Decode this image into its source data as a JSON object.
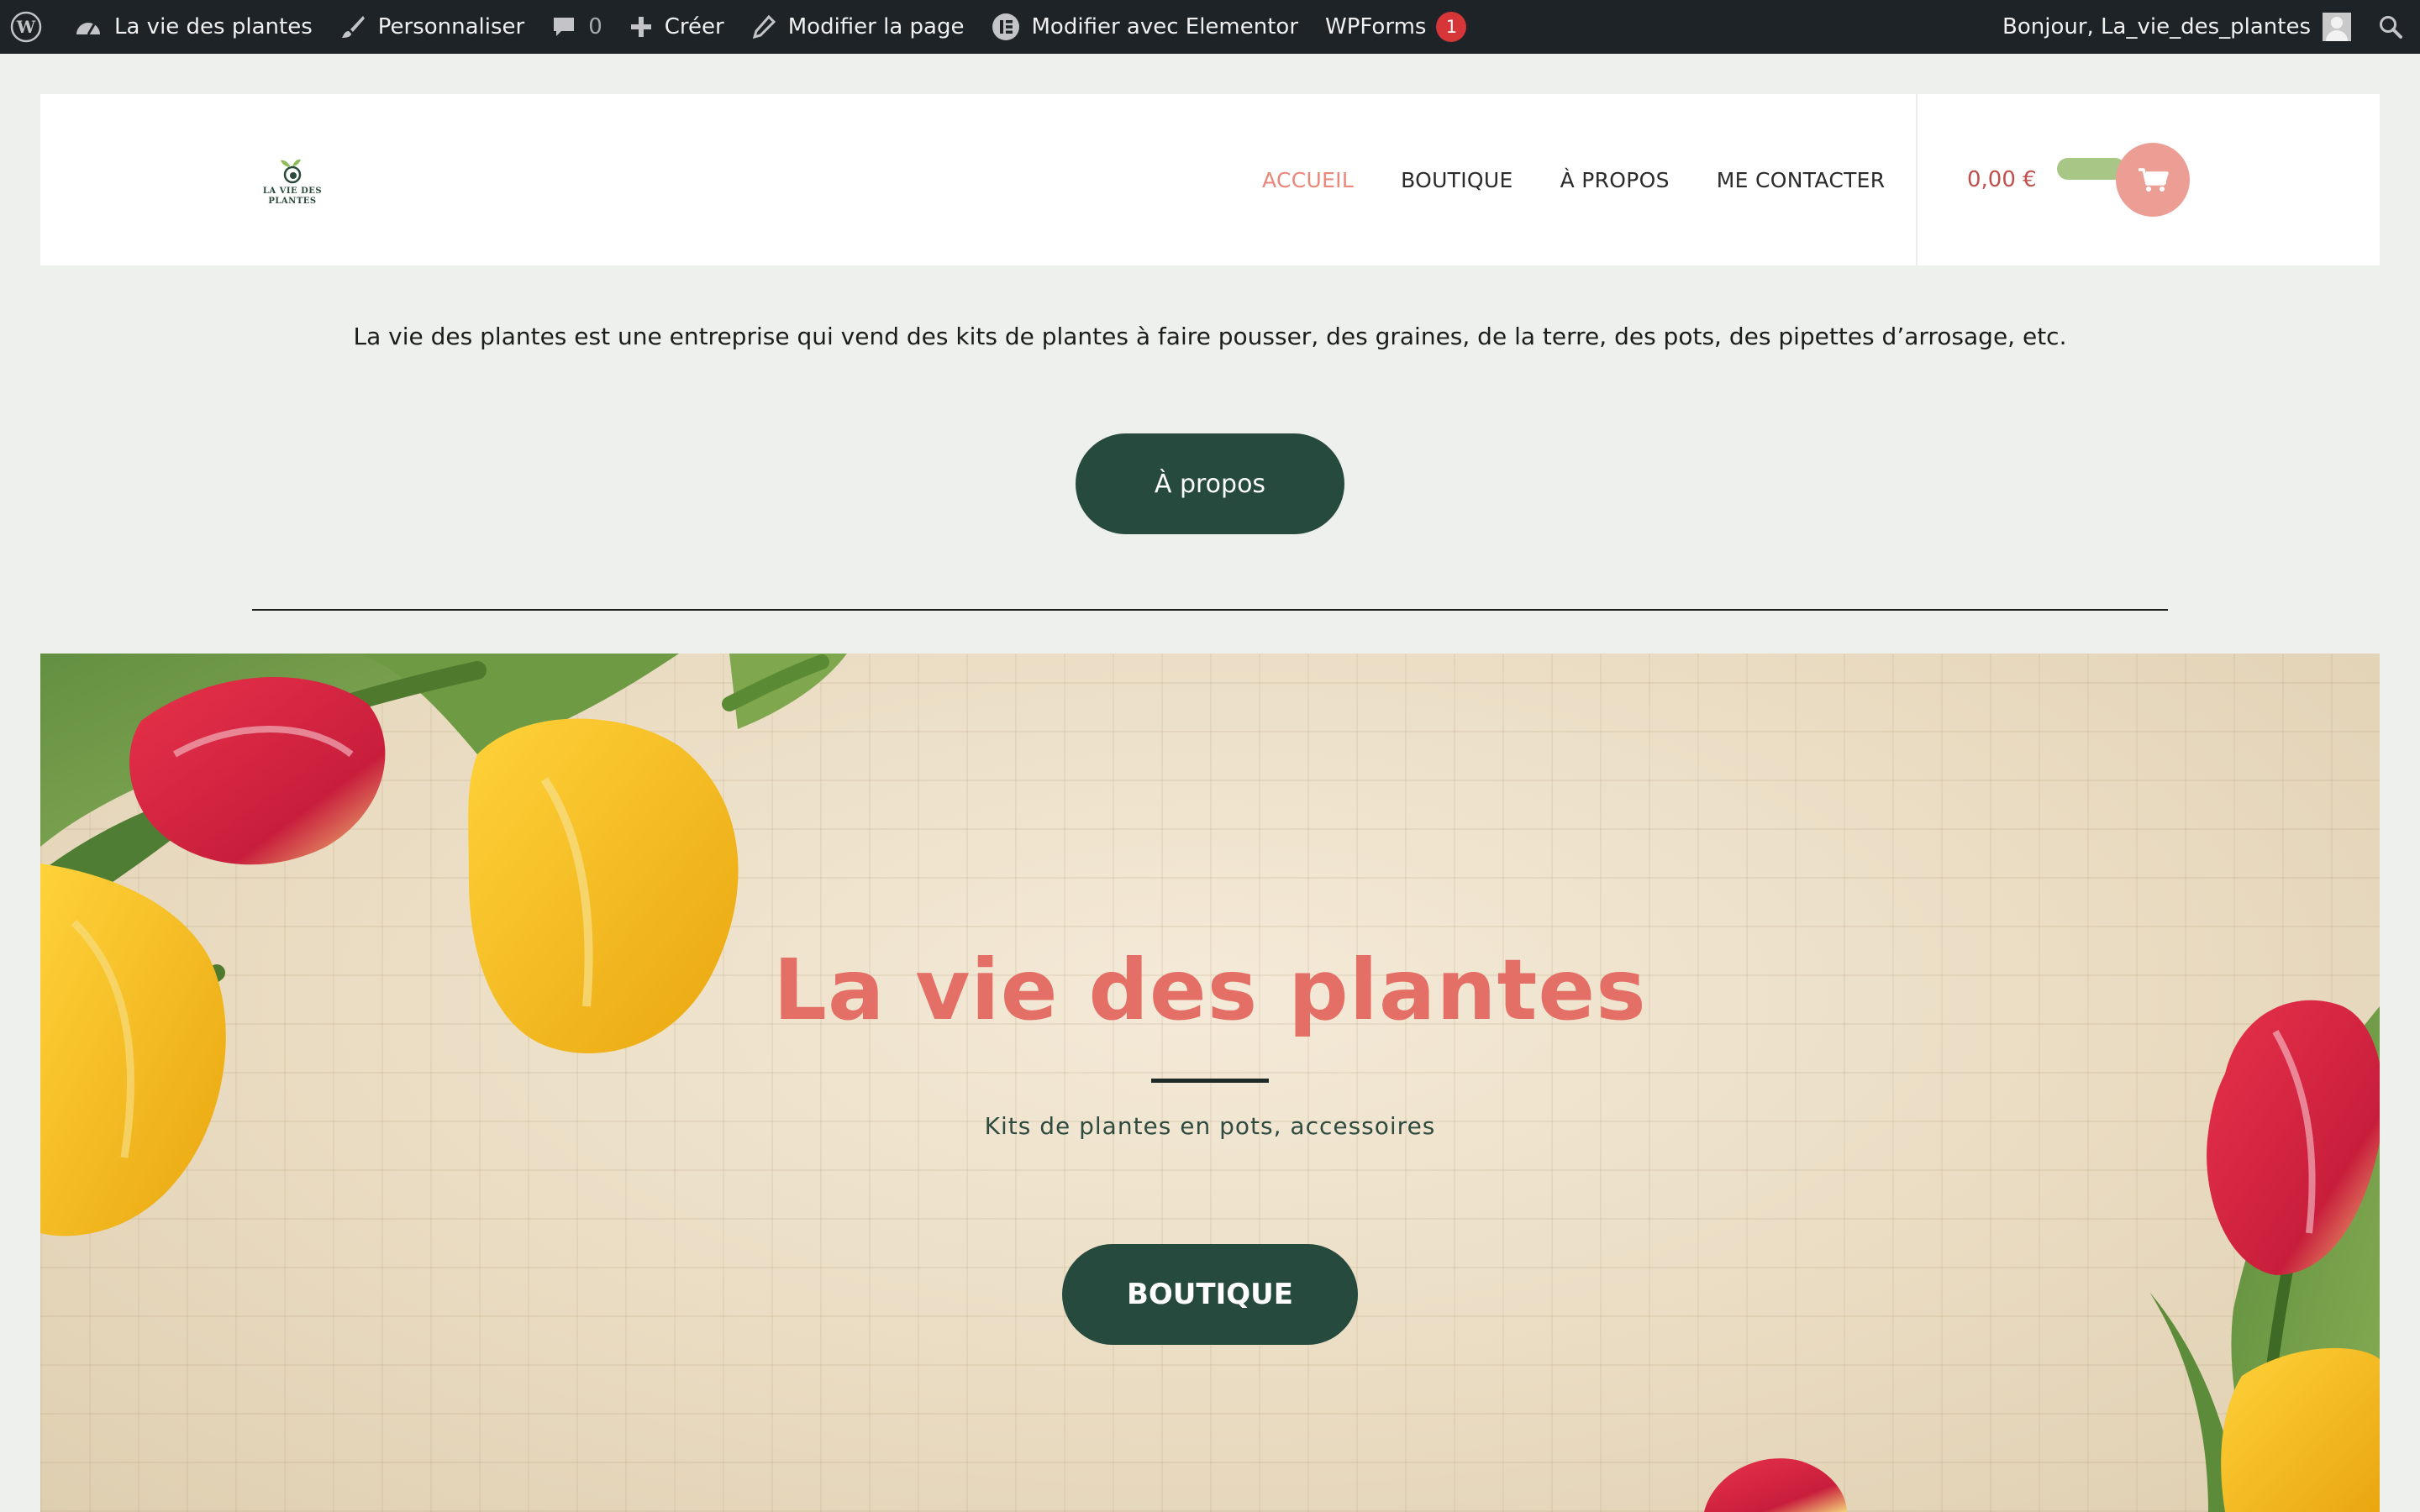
{
  "admin_bar": {
    "site_name": "La vie des plantes",
    "customize": "Personnaliser",
    "comments_count": "0",
    "new": "Créer",
    "edit_page": "Modifier la page",
    "edit_elementor": "Modifier avec Elementor",
    "wpforms": "WPForms",
    "wpforms_badge": "1",
    "greeting": "Bonjour, La_vie_des_plantes",
    "icons": [
      "wordpress-icon",
      "dashboard-icon",
      "brush-icon",
      "comment-icon",
      "plus-icon",
      "pencil-icon",
      "elementor-icon",
      "user-avatar",
      "search-icon"
    ]
  },
  "header": {
    "logo_text_line1": "LA VIE DES",
    "logo_text_line2": "PLANTES",
    "nav": [
      {
        "label": "ACCUEIL",
        "active": true
      },
      {
        "label": "BOUTIQUE",
        "active": false
      },
      {
        "label": "À PROPOS",
        "active": false
      },
      {
        "label": "ME CONTACTER",
        "active": false
      }
    ],
    "cart_total": "0,00 €",
    "cart_icon": "cart-icon"
  },
  "intro": {
    "text": "La vie des plantes est une entreprise qui vend des kits de plantes à faire pousser, des graines, de la terre, des pots, des pipettes d’arrosage, etc.",
    "button": "À propos"
  },
  "hero": {
    "title": "La vie des plantes",
    "subtitle": "Kits de plantes en pots, accessoires",
    "button": "BOUTIQUE"
  },
  "colors": {
    "admin_bar": "#1d2327",
    "accent_pink": "#e46f66",
    "active_nav": "#e9877a",
    "button_green": "#264a3d",
    "page_bg": "#edf0ec"
  }
}
